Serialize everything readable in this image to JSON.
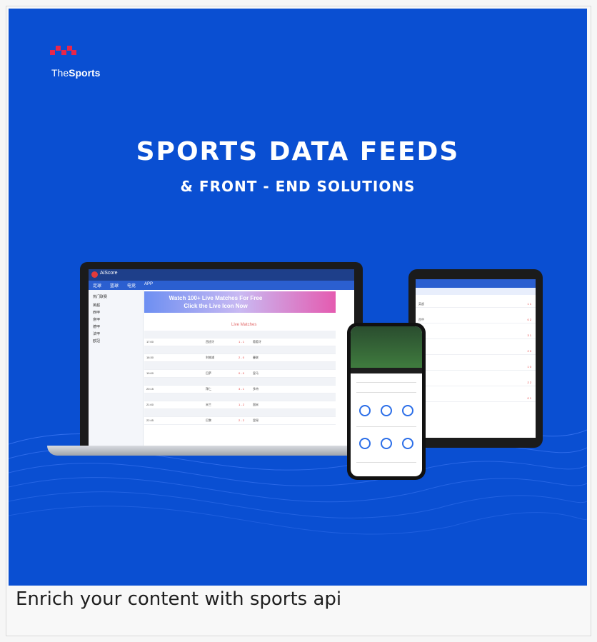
{
  "banner": {
    "logo_text_plain": "The",
    "logo_text_bold": "Sports",
    "headline": "SPORTS DATA FEEDS",
    "subheadline": "& FRONT - END SOLUTIONS",
    "bg_color": "#0a4fd2"
  },
  "laptop": {
    "app_title": "AiScore",
    "tabs": [
      "足球",
      "篮球",
      "电竞",
      "APP"
    ],
    "promo_line1": "Watch 100+ Live Matches For Free",
    "promo_line2": "Click the Live Icon Now",
    "live_label": "Live Matches",
    "sidebar_items": [
      "热门联赛",
      "英超",
      "西甲",
      "意甲",
      "德甲",
      "法甲",
      "欧冠"
    ],
    "rows": [
      {
        "time": "17:00",
        "home": "西班牙",
        "score": "1 - 1",
        "away": "葡萄牙"
      },
      {
        "time": "18:30",
        "home": "利物浦",
        "score": "2 - 0",
        "away": "曼联"
      },
      {
        "time": "19:00",
        "home": "巴萨",
        "score": "0 - 0",
        "away": "皇马"
      },
      {
        "time": "20:15",
        "home": "拜仁",
        "score": "3 - 1",
        "away": "多特"
      },
      {
        "time": "21:00",
        "home": "米兰",
        "score": "1 - 2",
        "away": "国米"
      },
      {
        "time": "22:45",
        "home": "巴黎",
        "score": "2 - 2",
        "away": "里昂"
      }
    ]
  },
  "tablet": {
    "rows": [
      {
        "name": "英超",
        "score": "1 1"
      },
      {
        "name": "西甲",
        "score": "0 2"
      },
      {
        "name": "意甲",
        "score": "3 1"
      },
      {
        "name": "德甲",
        "score": "2 0"
      },
      {
        "name": "法甲",
        "score": "1 0"
      },
      {
        "name": "荷甲",
        "score": "2 2"
      },
      {
        "name": "葡超",
        "score": "0 1"
      }
    ]
  },
  "caption": "Enrich your content with sports api"
}
